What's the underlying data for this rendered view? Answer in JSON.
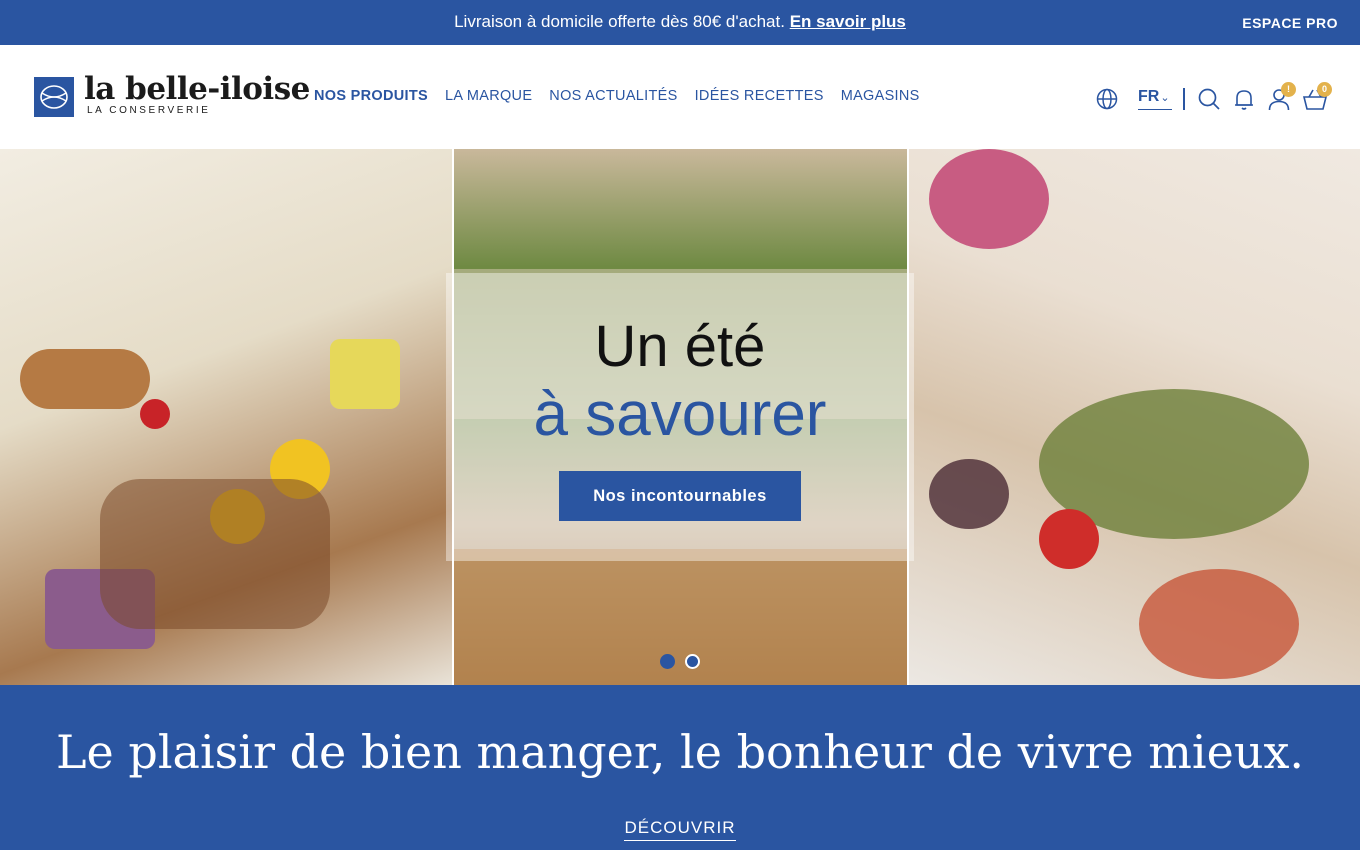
{
  "promo": {
    "text": "Livraison à domicile offerte dès 80€ d'achat.",
    "link": "En savoir plus",
    "pro_link": "ESPACE PRO"
  },
  "header": {
    "logo_name": "la belle-iloise",
    "logo_sub": "LA CONSERVERIE",
    "nav": [
      {
        "label": "NOS PRODUITS",
        "active": true
      },
      {
        "label": "LA MARQUE"
      },
      {
        "label": "NOS ACTUALITÉS"
      },
      {
        "label": "IDÉES RECETTES"
      },
      {
        "label": "MAGASINS"
      }
    ],
    "language": "FR",
    "icons": [
      "globe-icon",
      "search-icon",
      "bell-icon",
      "user-icon",
      "basket-icon"
    ],
    "account_badge": "!",
    "cart_count": "0"
  },
  "hero": {
    "line1": "Un été",
    "line2": "à savourer",
    "cta": "Nos incontournables",
    "slides_total": 2,
    "active_slide": 1
  },
  "band": {
    "title": "Le plaisir de bien manger, le bonheur de vivre mieux.",
    "link": "DÉCOUVRIR"
  },
  "colors": {
    "brand_blue": "#2a55a1",
    "badge_gold": "#e3b24c"
  }
}
